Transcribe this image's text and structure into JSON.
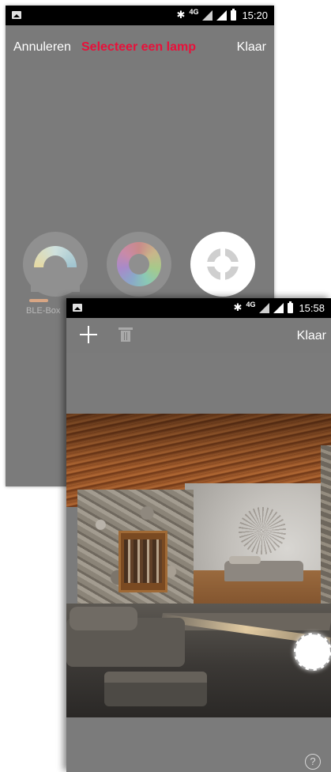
{
  "back_screen": {
    "status_bar": {
      "time": "15:20",
      "network": "4G"
    },
    "header": {
      "cancel_label": "Annuleren",
      "title": "Selecteer een lamp",
      "done_label": "Klaar"
    },
    "lamp_types": [
      {
        "icon": "white-temperature-icon",
        "selected": false
      },
      {
        "icon": "color-wheel-icon",
        "selected": false
      },
      {
        "icon": "target-lamp-icon",
        "selected": true
      }
    ],
    "lamp_label": "BLE-Box"
  },
  "front_screen": {
    "status_bar": {
      "time": "15:58",
      "network": "4G"
    },
    "header": {
      "add_icon": "plus-icon",
      "delete_icon": "trash-icon",
      "done_label": "Klaar"
    },
    "photo_icon": "interior-photo",
    "help_label": "?"
  },
  "colors": {
    "title_accent": "#e8113a",
    "statusbar": "#000000",
    "surface": "#7b7b7b",
    "text_on_surface": "#ffffff"
  }
}
